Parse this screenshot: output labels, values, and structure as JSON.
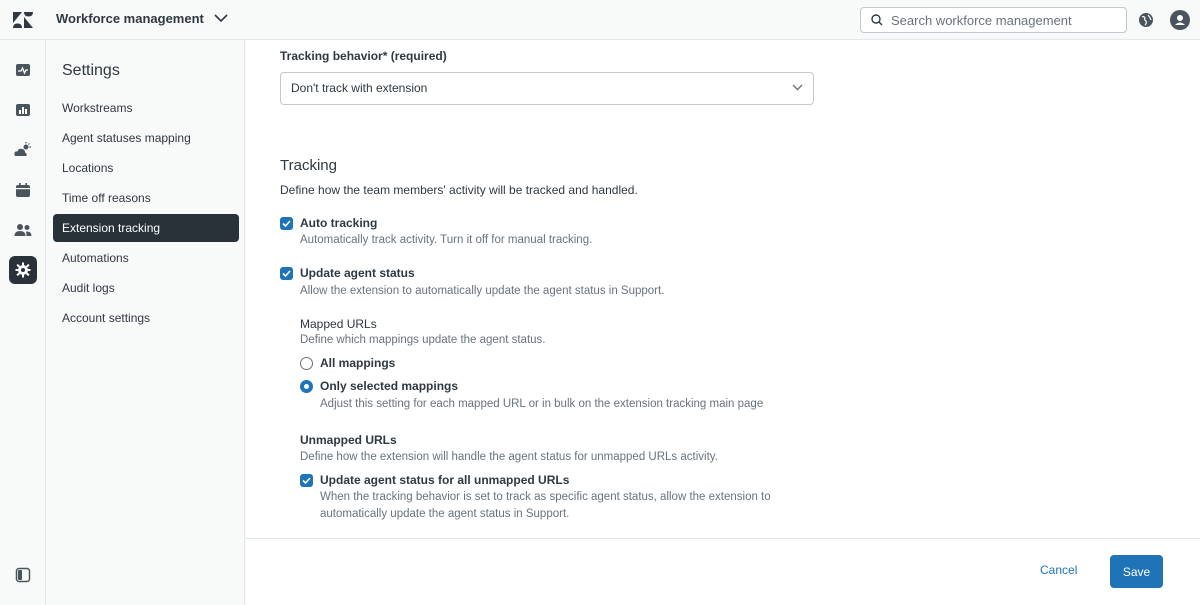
{
  "topbar": {
    "product_name": "Workforce management",
    "search_placeholder": "Search workforce management"
  },
  "rail": {
    "icons": [
      "activity-icon",
      "reports-icon",
      "forecast-icon",
      "calendar-icon",
      "team-icon",
      "settings-icon"
    ],
    "active": "settings-icon",
    "bottom_icon": "panel-toggle-icon"
  },
  "subnav": {
    "title": "Settings",
    "items": [
      {
        "label": "Workstreams"
      },
      {
        "label": "Agent statuses mapping"
      },
      {
        "label": "Locations"
      },
      {
        "label": "Time off reasons"
      },
      {
        "label": "Extension tracking"
      },
      {
        "label": "Automations"
      },
      {
        "label": "Audit logs"
      },
      {
        "label": "Account settings"
      }
    ],
    "active_item": "Extension tracking"
  },
  "main": {
    "tracking_behavior": {
      "label": "Tracking behavior* (required)",
      "value": "Don't track with extension"
    },
    "tracking": {
      "heading": "Tracking",
      "description": "Define how the team members' activity will be tracked and handled.",
      "auto_tracking": {
        "label": "Auto tracking",
        "hint": "Automatically track activity. Turn it off for manual tracking.",
        "checked": true
      },
      "update_agent_status": {
        "label": "Update agent status",
        "hint": "Allow the extension to automatically update the agent status in Support.",
        "checked": true
      },
      "mapped_urls": {
        "label": "Mapped URLs",
        "hint": "Define which mappings update the agent status.",
        "options": [
          {
            "label": "All mappings",
            "selected": false
          },
          {
            "label": "Only selected mappings",
            "selected": true,
            "hint": "Adjust this setting for each mapped URL or in bulk on the extension tracking main page"
          }
        ]
      },
      "unmapped_urls": {
        "label": "Unmapped URLs",
        "hint": "Define how the extension will handle the agent status for unmapped URLs activity.",
        "checkbox": {
          "label": "Update agent status for all unmapped URLs",
          "hint_line1": "When the tracking behavior is set to track as specific agent status, allow the extension to",
          "hint_line2": "automatically update the agent status in Support.",
          "checked": true
        }
      }
    },
    "footer": {
      "cancel_label": "Cancel",
      "save_label": "Save"
    }
  },
  "colors": {
    "accent": "#1f73b7",
    "nav_active": "#293238"
  }
}
